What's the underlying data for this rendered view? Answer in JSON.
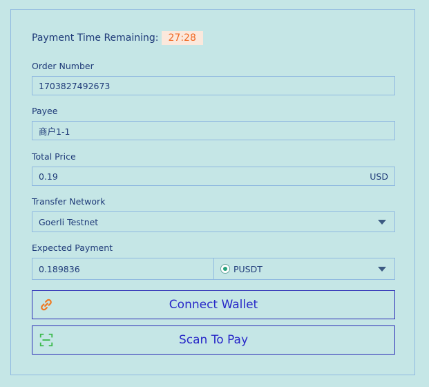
{
  "timer": {
    "label": "Payment Time Remaining:",
    "value": "27:28"
  },
  "order": {
    "label": "Order Number",
    "value": "1703827492673"
  },
  "payee": {
    "label": "Payee",
    "value": "商户1-1"
  },
  "total": {
    "label": "Total Price",
    "value": "0.19",
    "currency": "USD"
  },
  "network": {
    "label": "Transfer Network",
    "selected": "Goerli Testnet"
  },
  "expected": {
    "label": "Expected Payment",
    "amount": "0.189836",
    "token": "PUSDT",
    "token_icon": "tether-icon"
  },
  "buttons": {
    "connect_wallet": "Connect Wallet",
    "connect_icon": "link-icon",
    "scan_to_pay": "Scan To Pay",
    "scan_icon": "scan-icon"
  },
  "colors": {
    "background": "#c5e6e6",
    "accent": "#2828c8",
    "timer": "#f0661f",
    "scan_icon": "#3dba4e",
    "link_icon": "#f07820"
  }
}
